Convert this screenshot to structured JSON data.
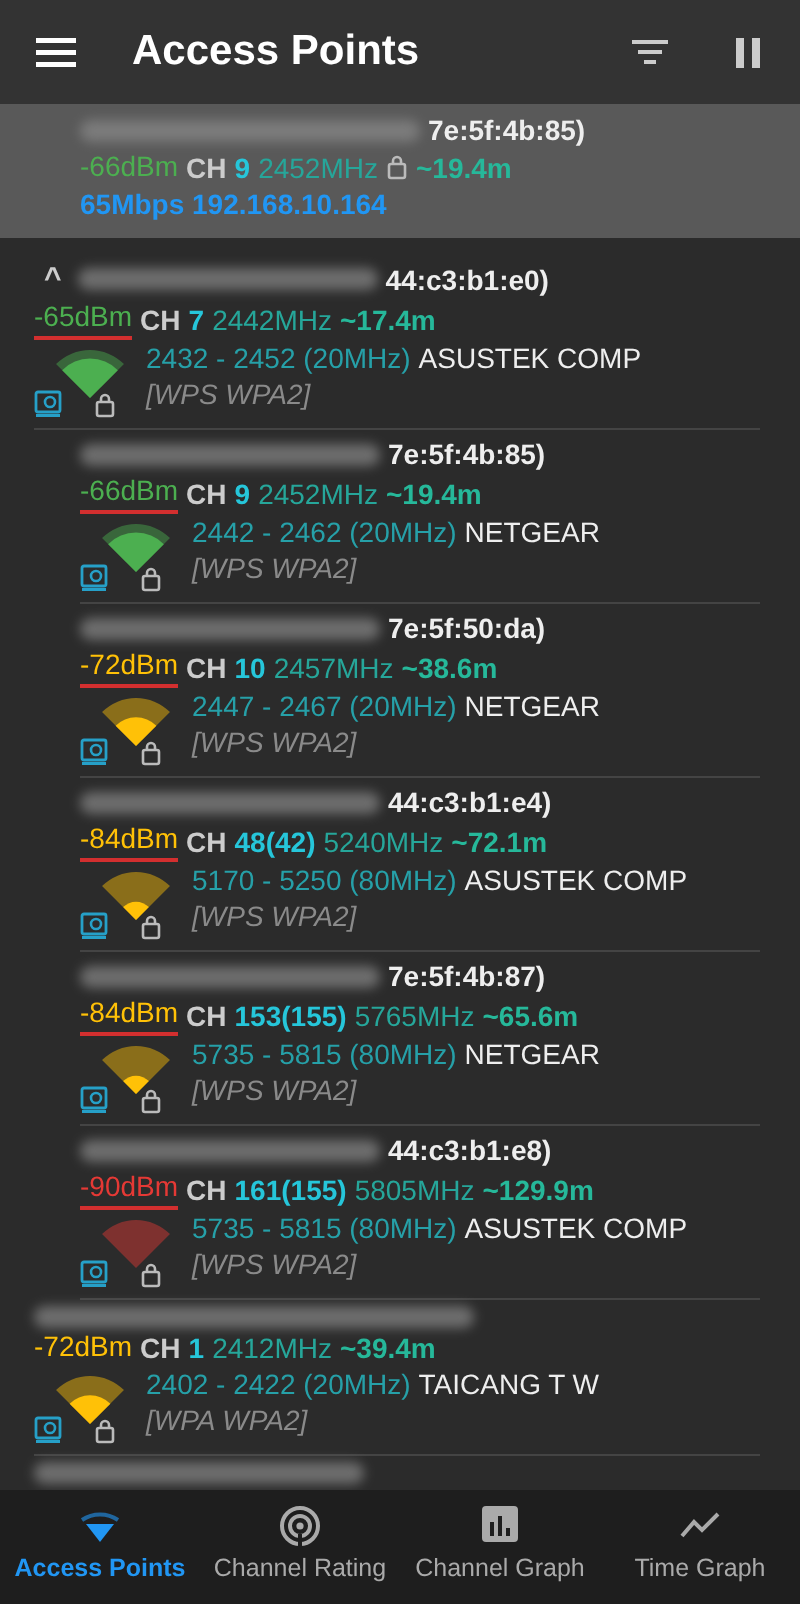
{
  "app_bar": {
    "title": "Access Points"
  },
  "connected": {
    "ssid_tail": "7e:5f:4b:85)",
    "signal": "-66dBm",
    "color": "#4caf50",
    "ch_label": "CH",
    "channel": "9",
    "frequency": "2452MHz",
    "locked": true,
    "distance": "~19.4m",
    "link": "65Mbps 192.168.10.164"
  },
  "access_points": [
    {
      "kind": "strong",
      "expander": "^",
      "expanded": true,
      "ssid_tail": "44:c3:b1:e0)",
      "signal": "-65dBm",
      "color": "#4caf50",
      "underlined": true,
      "ch_label": "CH",
      "channel": "7",
      "frequency": "2442MHz",
      "distance": "~17.4m",
      "range": "2432 - 2452 (20MHz)",
      "vendor": "ASUSTEK COMP",
      "capabilities": "[WPS WPA2]",
      "children": [
        {
          "ssid_tail": "7e:5f:4b:85)",
          "signal": "-66dBm",
          "color": "#4caf50",
          "underlined": true,
          "kind": "strong",
          "ch_label": "CH",
          "channel": "9",
          "frequency": "2452MHz",
          "distance": "~19.4m",
          "range": "2442 - 2462 (20MHz)",
          "vendor": "NETGEAR",
          "capabilities": "[WPS WPA2]"
        },
        {
          "ssid_tail": "7e:5f:50:da)",
          "signal": "-72dBm",
          "color": "#ffc107",
          "underlined": true,
          "kind": "fair",
          "ch_label": "CH",
          "channel": "10",
          "frequency": "2457MHz",
          "distance": "~38.6m",
          "range": "2447 - 2467 (20MHz)",
          "vendor": "NETGEAR",
          "capabilities": "[WPS WPA2]"
        },
        {
          "ssid_tail": "44:c3:b1:e4)",
          "signal": "-84dBm",
          "color": "#ffc107",
          "underlined": true,
          "kind": "weak",
          "ch_label": "CH",
          "channel": "48(42)",
          "frequency": "5240MHz",
          "distance": "~72.1m",
          "range": "5170 - 5250 (80MHz)",
          "vendor": "ASUSTEK COMP",
          "capabilities": "[WPS WPA2]"
        },
        {
          "ssid_tail": "7e:5f:4b:87)",
          "signal": "-84dBm",
          "color": "#ffc107",
          "underlined": true,
          "kind": "weak",
          "ch_label": "CH",
          "channel": "153(155)",
          "frequency": "5765MHz",
          "distance": "~65.6m",
          "range": "5735 - 5815 (80MHz)",
          "vendor": "NETGEAR",
          "capabilities": "[WPS WPA2]"
        },
        {
          "ssid_tail": "44:c3:b1:e8)",
          "signal": "-90dBm",
          "color": "#e53935",
          "underlined": true,
          "kind": "poor",
          "ch_label": "CH",
          "channel": "161(155)",
          "frequency": "5805MHz",
          "distance": "~129.9m",
          "range": "5735 - 5815 (80MHz)",
          "vendor": "ASUSTEK COMP",
          "capabilities": "[WPS WPA2]"
        }
      ]
    },
    {
      "kind": "fair",
      "signal": "-72dBm",
      "color": "#ffc107",
      "underlined": false,
      "ch_label": "CH",
      "channel": "1",
      "frequency": "2412MHz",
      "distance": "~39.4m",
      "range": "2402 - 2422 (20MHz)",
      "vendor": "TAICANG T W",
      "capabilities": "[WPA WPA2]"
    },
    {
      "kind": "redacted"
    }
  ],
  "bottom_nav": [
    {
      "label": "Access Points",
      "selected": true
    },
    {
      "label": "Channel Rating",
      "selected": false
    },
    {
      "label": "Channel Graph",
      "selected": false
    },
    {
      "label": "Time Graph",
      "selected": false
    }
  ]
}
